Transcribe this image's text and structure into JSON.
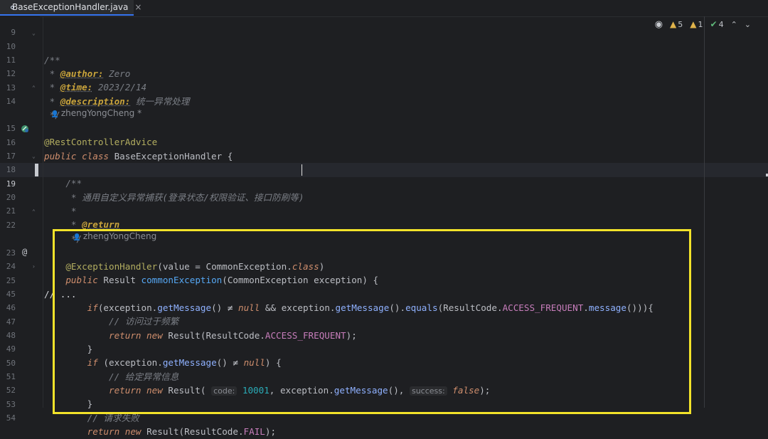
{
  "tab": {
    "filename": "BaseExceptionHandler.java",
    "close": "×"
  },
  "inspections": {
    "warnings": "5",
    "weak_warnings": "1",
    "typos": "4",
    "colors": {
      "warning": "#e0b34a",
      "ok": "#5fb87a"
    }
  },
  "authors": {
    "class": "zhengYongCheng *",
    "method": "zhengYongCheng"
  },
  "line_numbers": {
    "l9": "9",
    "l10": "10",
    "l11": "11",
    "l12": "12",
    "l13": "13",
    "l14": "14",
    "l15": "15",
    "l16": "16",
    "l17": "17",
    "l18": "18",
    "l19": "19",
    "l20": "20",
    "l21": "21",
    "l22": "22",
    "l23": "23",
    "l24": "24",
    "l25": "25",
    "l45": "45",
    "l46": "46",
    "l47": "47",
    "l48": "48",
    "l49": "49",
    "l50": "50",
    "l51": "51",
    "l52": "52",
    "l53": "53",
    "l54": "54"
  },
  "code": {
    "c10": "/**",
    "c11_star": " * ",
    "c11_tag": "@author:",
    "c11_val": " Zero",
    "c12_star": " * ",
    "c12_tag": "@time:",
    "c12_val": " 2023/2/14",
    "c13_star": " * ",
    "c13_tag": "@description:",
    "c13_val": " 统一异常处理",
    "c14": " */",
    "c15": "@RestControllerAdvice",
    "c16_kw": "public class",
    "c16_name": " BaseExceptionHandler {",
    "c18": "    /**",
    "c19": "     * 通用自定义异常捕获(登录状态/权限验证、接口防刷等)",
    "c20": "     *",
    "c21_star": "     * ",
    "c21_tag": "@return",
    "c22": "     */",
    "c23_ann": "    @ExceptionHandler",
    "c23_a": "(value = ",
    "c23_t": "CommonException",
    "c23_b": ".",
    "c23_cls": "class",
    "c23_c": ")",
    "c24_kw": "    public",
    "c24_a": " Result ",
    "c24_fn": "commonException",
    "c24_b": "(CommonException exception) {",
    "c25": "// ...",
    "c45_kw": "        if",
    "c45_a": "(exception.",
    "c45_m1": "getMessage",
    "c45_b": "() ",
    "c45_ne": "≠",
    "c45_null": " null",
    "c45_c": " && exception.",
    "c45_m2": "getMessage",
    "c45_d": "().",
    "c45_m3": "equals",
    "c45_e": "(ResultCode.",
    "c45_f": "ACCESS_FREQUENT",
    "c45_g": ".",
    "c45_h": "message",
    "c45_i": "())){",
    "c46": "            // 访问过于频繁",
    "c47_kw": "            return new",
    "c47_a": " Result(ResultCode.",
    "c47_f": "ACCESS_FREQUENT",
    "c47_b": ");",
    "c48": "        }",
    "c49_kw": "        if",
    "c49_a": " (exception.",
    "c49_m": "getMessage",
    "c49_b": "() ",
    "c49_ne": "≠",
    "c49_null": " null",
    "c49_c": ") {",
    "c50": "            // 给定异常信息",
    "c51_kw": "            return new",
    "c51_a": " Result( ",
    "c51_h1": "code:",
    "c51_n": " 10001",
    "c51_b": ", exception.",
    "c51_m": "getMessage",
    "c51_c": "(), ",
    "c51_h2": "success:",
    "c51_f": " false",
    "c51_d": ");",
    "c52": "        }",
    "c53": "        // 请求失败",
    "c54_kw": "        return new",
    "c54_a": " Result(ResultCode.",
    "c54_f": "FAIL",
    "c54_b": ");"
  }
}
